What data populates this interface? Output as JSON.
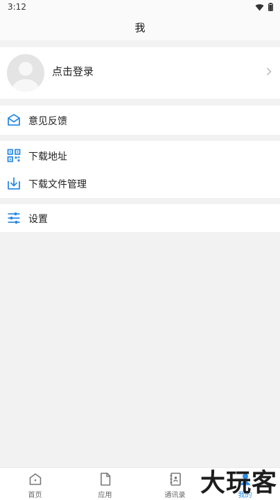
{
  "status_bar": {
    "time": "3:12"
  },
  "header": {
    "title": "我"
  },
  "login": {
    "label": "点击登录"
  },
  "menu": {
    "feedback": "意见反馈",
    "download_address": "下载地址",
    "download_manager": "下载文件管理",
    "settings": "设置"
  },
  "tabs": [
    {
      "label": "首页",
      "icon": "home-icon"
    },
    {
      "label": "应用",
      "icon": "file-icon"
    },
    {
      "label": "通讯录",
      "icon": "contacts-icon"
    },
    {
      "label": "我的",
      "icon": "profile-icon",
      "active": true
    }
  ],
  "watermark": "大玩客",
  "colors": {
    "accent": "#2b8be6",
    "background": "#f2f2f2",
    "card": "#ffffff"
  }
}
